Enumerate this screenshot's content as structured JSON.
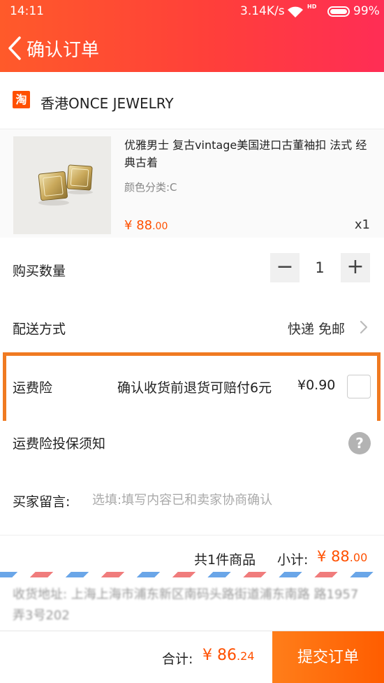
{
  "status_bar": {
    "time": "14:11",
    "speed": "3.14K/s",
    "hd": "HD",
    "battery": "99%"
  },
  "nav": {
    "title": "确认订单",
    "back_icon": "chevron-left-icon"
  },
  "shop": {
    "icon_text": "淘",
    "name": "香港ONCE JEWELRY"
  },
  "product": {
    "title": "优雅男士 复古vintage美国进口古董袖扣 法式 经典古着",
    "variant": "颜色分类:C",
    "price_symbol": "¥",
    "price_int": "88",
    "price_dec": ".00",
    "quantity": "x1"
  },
  "quantity_row": {
    "label": "购买数量",
    "minus": "−",
    "value": "1",
    "plus": "+"
  },
  "shipping_row": {
    "label": "配送方式",
    "value": "快递 免邮"
  },
  "insurance_row": {
    "label": "运费险",
    "desc": "确认收货前退货可赔付6元",
    "price": "¥0.90",
    "checked": false
  },
  "notice_row": {
    "label": "运费险投保须知",
    "help_icon": "?"
  },
  "message_row": {
    "label": "买家留言:",
    "placeholder": "选填:填写内容已和卖家协商确认"
  },
  "totals": {
    "count": "共1件商品",
    "subtotal_label": "小计:",
    "subtotal_symbol": "¥",
    "subtotal_int": "88",
    "subtotal_dec": ".00"
  },
  "address": {
    "text": "收货地址: 上海上海市浦东新区南码头路街道浦东南路 路1957弄3号202"
  },
  "footer": {
    "total_label": "合计:",
    "total_symbol": "¥",
    "total_int": "86",
    "total_dec": ".24",
    "submit_label": "提交订单"
  },
  "colors": {
    "accent": "#ff5000",
    "highlight_border": "#f07a21"
  }
}
